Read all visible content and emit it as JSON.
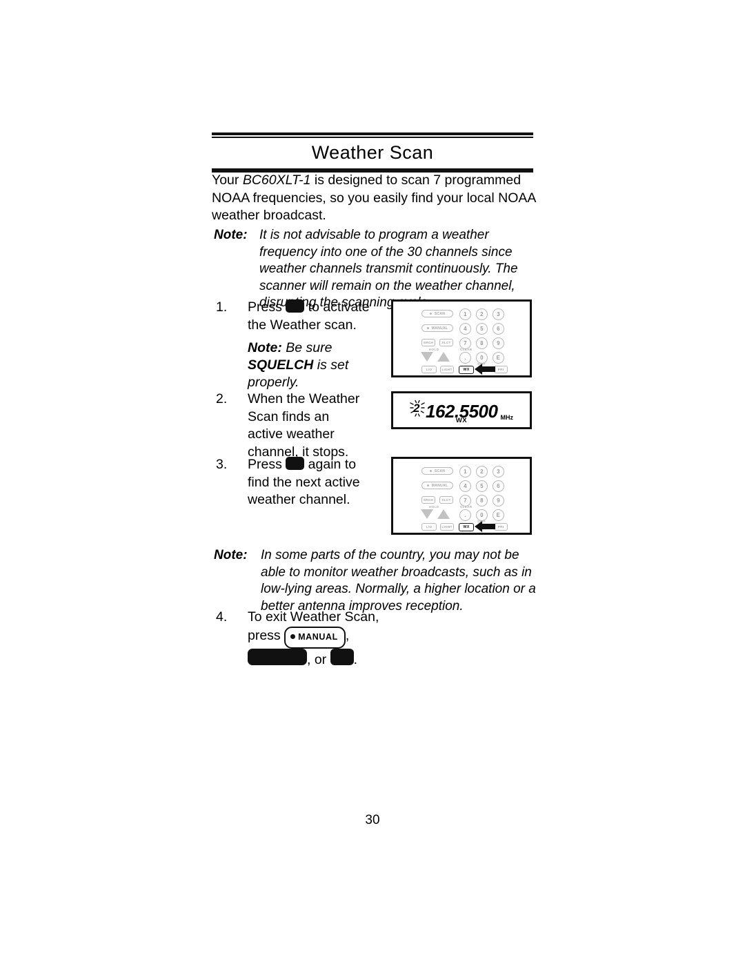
{
  "document": {
    "title": "Weather Scan",
    "page_number": "30"
  },
  "intro": {
    "before_model": "Your ",
    "model": "BC60XLT-1",
    "after_model": " is designed to scan 7 programmed NOAA frequencies, so you easily find your local NOAA weather broadcast."
  },
  "notes": [
    {
      "label": "Note:",
      "text": "It is not advisable to program a weather frequency into one of the 30 channels since weather channels transmit continuously. The scanner will remain on the weather channel, disrupting the scanning cycle."
    },
    {
      "label": "Note:",
      "text": "In some parts of the country, you may not be able to monitor weather broadcasts, such as in low-lying areas. Normally, a higher location or a better antenna improves reception."
    }
  ],
  "steps": [
    {
      "number": "1.",
      "text_before_key": "Press ",
      "key": "wx-key",
      "text_after_key": " to activate the Weather scan."
    },
    {
      "number": "2.",
      "text_before_key": "When the Weather Scan finds an active weather channel, it stops.",
      "key": "",
      "text_after_key": ""
    },
    {
      "number": "3.",
      "text_before_key": "Press ",
      "key": "wx-key",
      "text_after_key": " again to find the next active weather channel."
    },
    {
      "number": "4.",
      "text_before_key": "To exit Weather Scan, press ",
      "manual_key_label": "MANUAL",
      "text_middle": ", ",
      "text_after_key": ", or ",
      "text_end": "."
    }
  ],
  "squelch_note": {
    "label": "Note:",
    "text_before_bold": " Be sure ",
    "bold_term": "SQUELCH",
    "text_after_bold": " is set properly."
  },
  "display": {
    "flashing_digit": "2",
    "frequency": "162.5500",
    "unit": "MHz",
    "mode": "WX"
  },
  "keypad": {
    "scan_label": "SCAN",
    "manual_label": "MANUAL",
    "srch_label": "SRCH",
    "slct_label": "SLCT",
    "hold_label": "HOLD",
    "clear_label": "CLEAR",
    "skip_label": "SKIP",
    "lockout_label": "L/O",
    "light_label": "LIGHT",
    "wx_label": "WX",
    "pri_label": "PRI",
    "dot_label": ".",
    "e_label": "E",
    "numbers": [
      "1",
      "2",
      "3",
      "4",
      "5",
      "6",
      "7",
      "8",
      "9",
      "0"
    ]
  },
  "colors": {
    "ink": "#111111",
    "keypad_gray": "#b9b9b9",
    "page_background": "#ffffff"
  }
}
